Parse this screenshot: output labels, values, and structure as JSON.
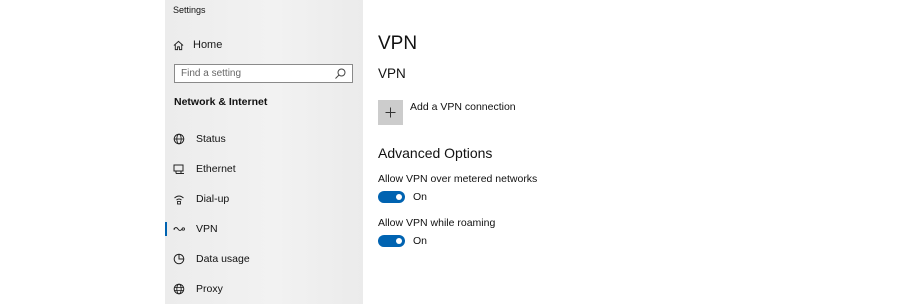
{
  "app": {
    "title": "Settings"
  },
  "sidebar": {
    "home_label": "Home",
    "search_placeholder": "Find a setting",
    "section_heading": "Network & Internet",
    "items": [
      {
        "label": "Status",
        "icon": "globe-icon"
      },
      {
        "label": "Ethernet",
        "icon": "ethernet-icon"
      },
      {
        "label": "Dial-up",
        "icon": "dial-up-icon"
      },
      {
        "label": "VPN",
        "icon": "vpn-icon",
        "selected": true
      },
      {
        "label": "Data usage",
        "icon": "data-usage-icon"
      },
      {
        "label": "Proxy",
        "icon": "proxy-globe-icon"
      }
    ]
  },
  "main": {
    "page_title": "VPN",
    "vpn_section_title": "VPN",
    "add_vpn_label": "Add a VPN connection",
    "advanced_title": "Advanced Options",
    "options": [
      {
        "label": "Allow VPN over metered networks",
        "state": "On",
        "on": true
      },
      {
        "label": "Allow VPN while roaming",
        "state": "On",
        "on": true
      }
    ]
  },
  "colors": {
    "accent": "#0063b1",
    "sidebar_bg": "#eeeeee",
    "add_tile_bg": "#cccccc"
  }
}
